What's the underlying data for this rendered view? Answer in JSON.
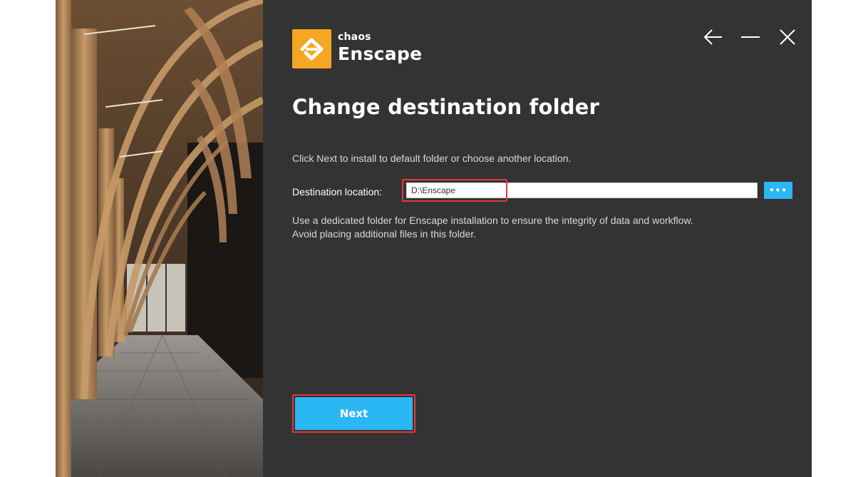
{
  "brand": {
    "company": "chaos",
    "product": "Enscape",
    "accent_color": "#f5a623"
  },
  "window_controls": {
    "back_icon": "arrow-left-icon",
    "minimize_icon": "minimize-icon",
    "close_icon": "close-icon"
  },
  "page": {
    "title": "Change destination folder",
    "instruction": "Click Next to install to default folder or choose another location.",
    "destination": {
      "label": "Destination location:",
      "value": "D:\\Enscape",
      "browse_label": "•••"
    },
    "note_line1": "Use a dedicated folder for Enscape installation to ensure the integrity of data and workflow.",
    "note_line2": "Avoid placing additional files in this folder."
  },
  "actions": {
    "next_label": "Next",
    "button_color": "#2bb6f4"
  },
  "annotations": {
    "highlight_color": "#e53935"
  }
}
